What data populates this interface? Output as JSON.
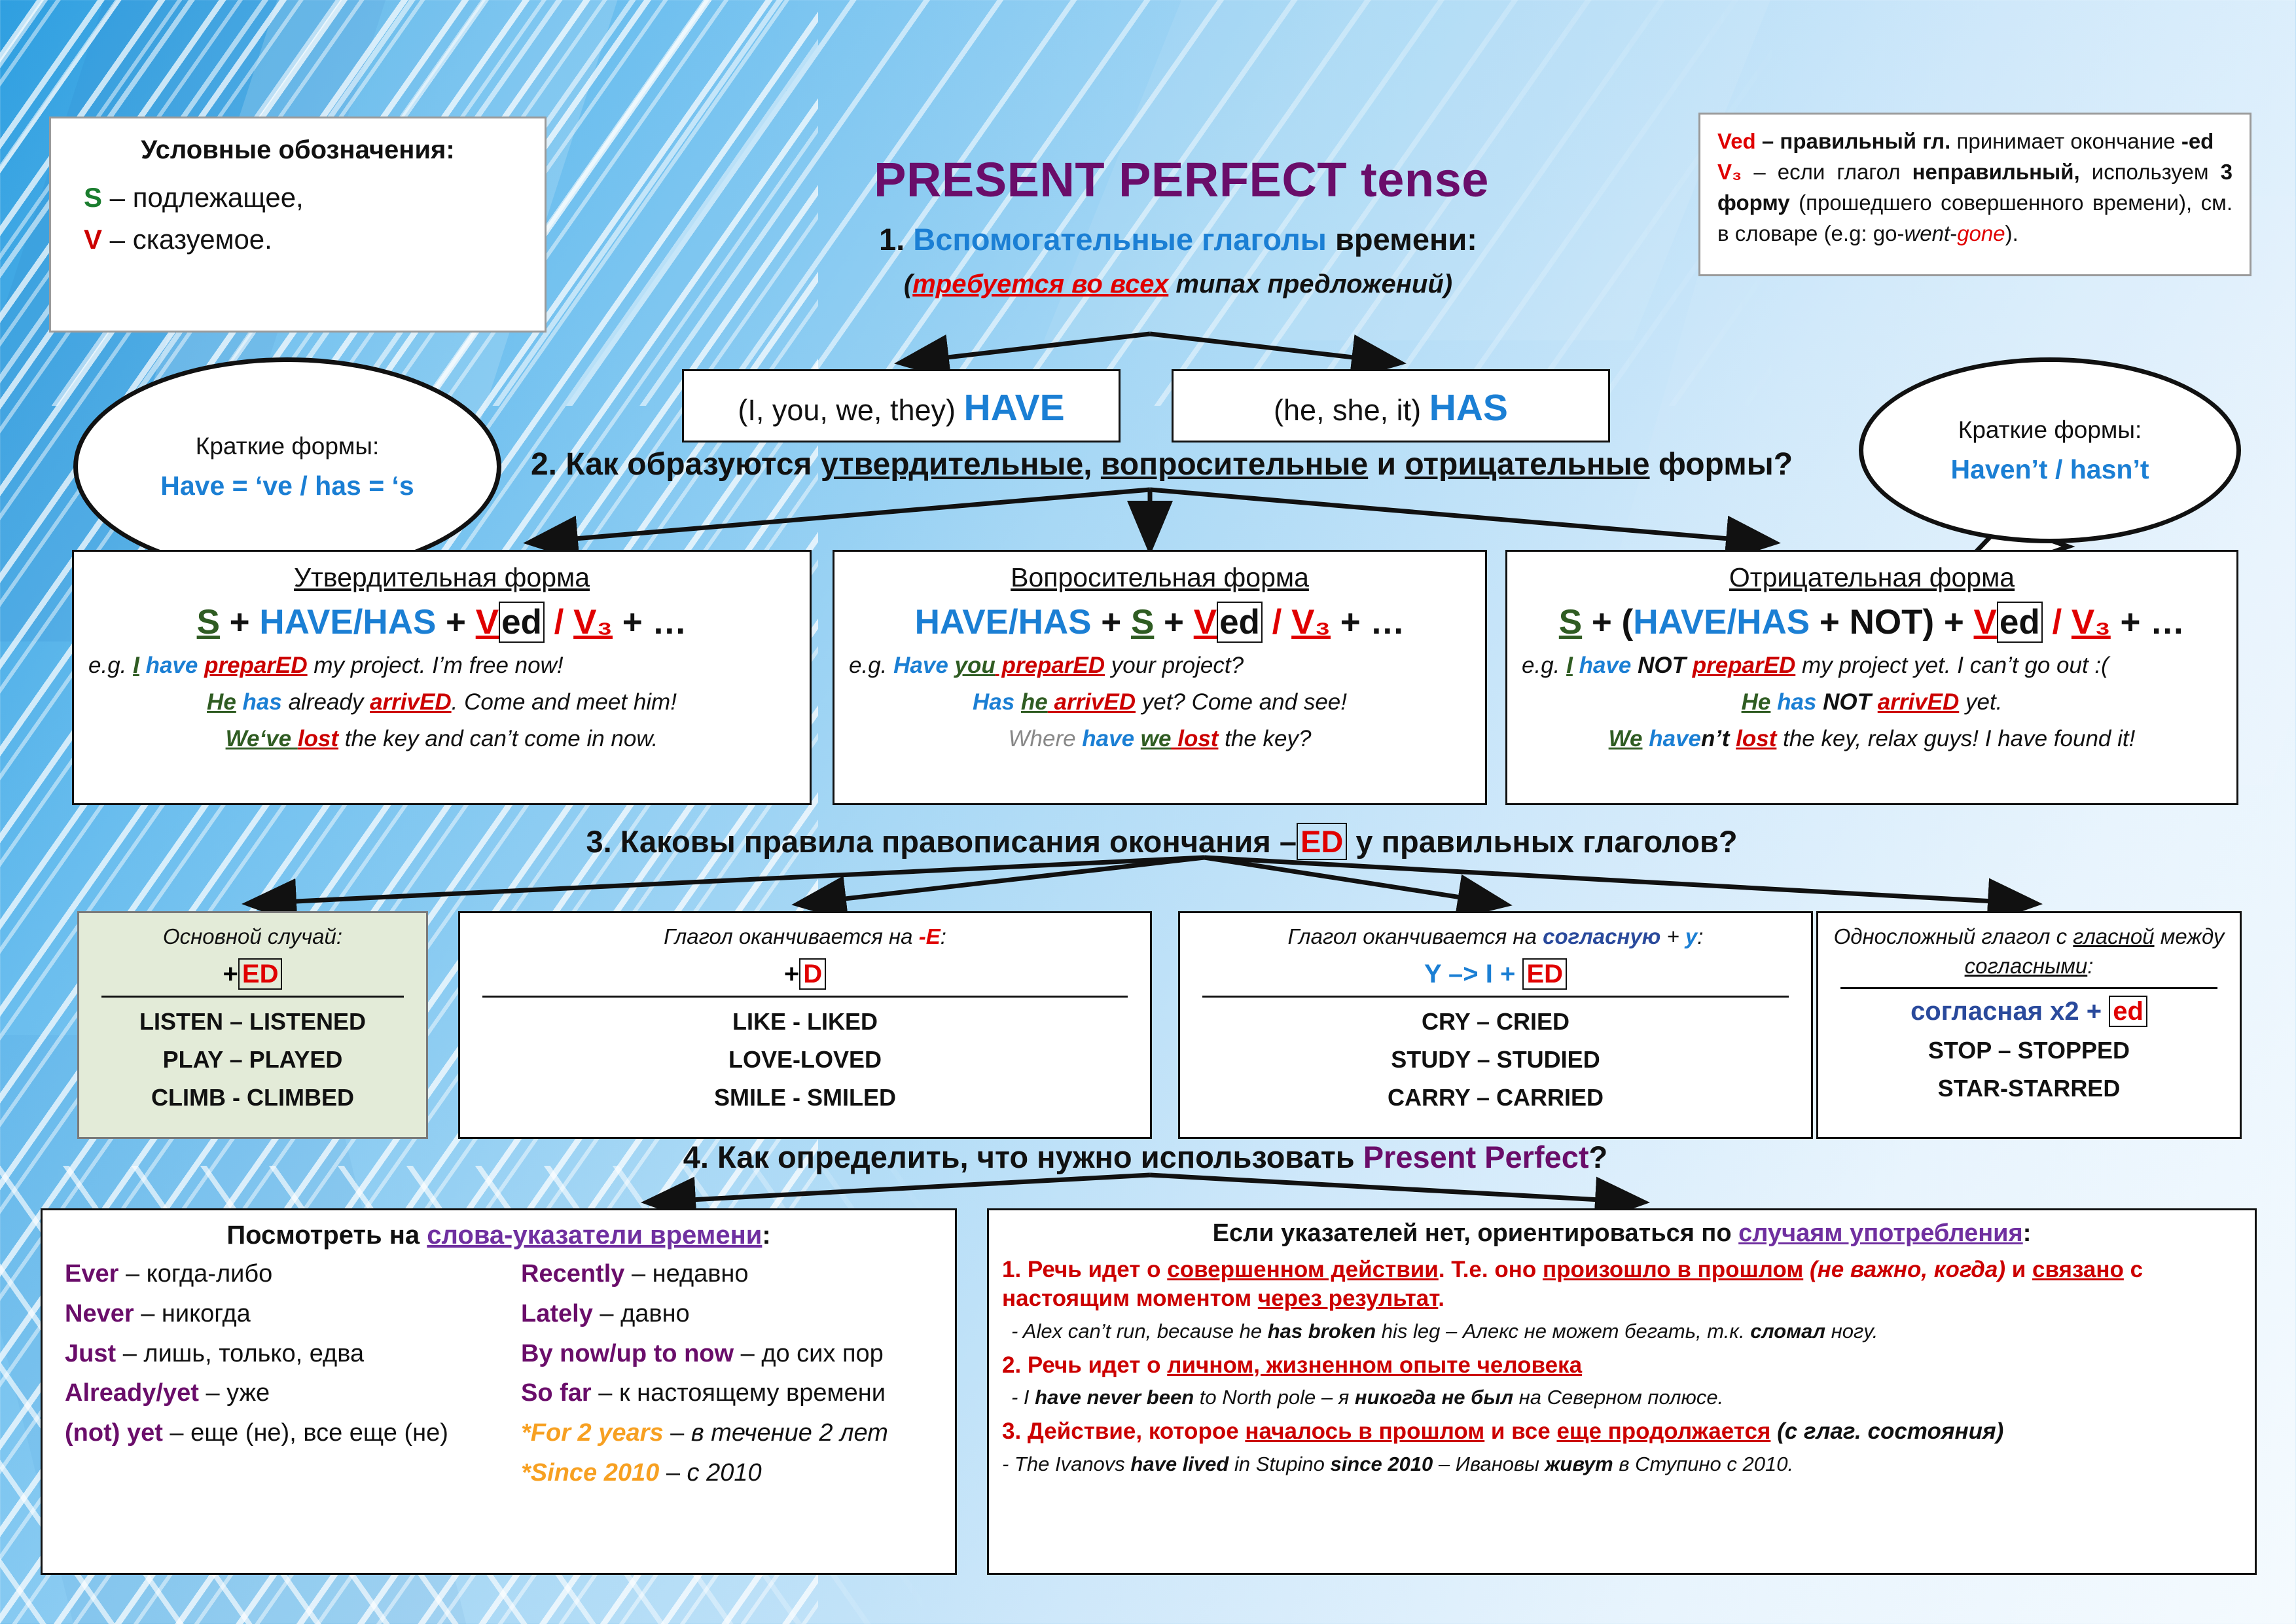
{
  "legend_left": {
    "title": "Условные обозначения:",
    "line1_sym": "S",
    "line1_text": " – подлежащее,",
    "line2_sym": "V",
    "line2_text": " – сказуемое."
  },
  "legend_right": {
    "ved_sym": "Ved",
    "ved_text_bold": " – правильный гл.",
    "ved_text": " принимает окончание ",
    "ved_end": "-ed",
    "v3_sym": "V₃",
    "v3_a": " – если глагол ",
    "v3_b": "неправильный,",
    "v3_c": " используем ",
    "v3_d": "3 форму",
    "v3_e": " (прошедшего совершенного времени), см. в словаре (e.g: go-",
    "v3_went": "went",
    "v3_dash": "-",
    "v3_gone": "gone",
    "v3_close": ")."
  },
  "title": "PRESENT PERFECT tense",
  "section1": {
    "num": "1. ",
    "blue": "Вспомогательные глаголы",
    "rest": " времени:",
    "sub_open": "(",
    "sub_red": "требуется во всех",
    "sub_rest": " типах предложений)"
  },
  "aux": {
    "have_pron": "(I, you, we, they) ",
    "have_word": "HAVE",
    "has_pron": "(he, she, it) ",
    "has_word": "HAS"
  },
  "bubble_left": {
    "title": "Краткие формы:",
    "content": "Have = ‘ve / has = ‘s"
  },
  "bubble_right": {
    "title": "Краткие формы:",
    "content": "Haven’t / hasn’t"
  },
  "section2": {
    "num": "2. Как образуются ",
    "w1": "утвердительные",
    "comma": ", ",
    "w2": "вопросительные",
    "and": " и ",
    "w3": "отрицательные",
    "end": " формы?"
  },
  "affirmative": {
    "title": "Утвердительная форма",
    "f_s": "S",
    "f_plus1": " + ",
    "f_aux": "HAVE/HAS",
    "f_plus2": " + ",
    "f_v": "V",
    "f_ed": "ed",
    "f_slash": " / ",
    "f_v3": "V₃",
    "f_tail": " + …",
    "ex1_eg": "e.g. ",
    "ex1_s": "I",
    "ex1_aux": " have ",
    "ex1_verb": "preparED",
    "ex1_rest": " my project. I’m free now!",
    "ex2_s": "He",
    "ex2_aux": " has ",
    "ex2_mid": "already ",
    "ex2_verb": "arrivED",
    "ex2_rest": ". Come and meet him!",
    "ex3_s": "We‘ve ",
    "ex3_verb": "lost",
    "ex3_rest": " the key and can’t come in now."
  },
  "question": {
    "title": "Вопросительная форма",
    "f_aux": "HAVE/HAS",
    "f_plus1": " + ",
    "f_s": "S",
    "f_plus2": " + ",
    "f_v": "V",
    "f_ed": "ed",
    "f_slash": " / ",
    "f_v3": "V₃",
    "f_tail": " + …",
    "ex1_eg": "e.g. ",
    "ex1_aux": "Have ",
    "ex1_s": "you",
    "ex1_verb": " preparED",
    "ex1_rest": " your project?",
    "ex2_aux": "Has ",
    "ex2_s": "he",
    "ex2_verb": " arrivED",
    "ex2_rest": " yet? Come and see!",
    "ex3_wh": "Where ",
    "ex3_aux": "have ",
    "ex3_s": "we",
    "ex3_verb": " lost",
    "ex3_rest": " the key?"
  },
  "negative": {
    "title": "Отрицательная форма",
    "f_s": "S",
    "f_p1": " + (",
    "f_aux": "HAVE/HAS",
    "f_p2": " + ",
    "f_not": "NOT",
    "f_p3": ") + ",
    "f_v": "V",
    "f_ed": "ed",
    "f_slash": " / ",
    "f_v3": "V₃",
    "f_tail": " + …",
    "ex1_eg": "e.g. ",
    "ex1_s": "I",
    "ex1_aux": " have ",
    "ex1_not": "NOT ",
    "ex1_verb": "preparED",
    "ex1_rest": " my project yet. I can’t go out :(",
    "ex2_s": "He",
    "ex2_aux": " has ",
    "ex2_not": "NOT ",
    "ex2_verb": "arrivED",
    "ex2_rest": " yet.",
    "ex3_s": "We",
    "ex3_aux": " have",
    "ex3_nt": "n’t ",
    "ex3_verb": "lost",
    "ex3_rest": " the key, relax guys! I have found it!"
  },
  "section3": {
    "pre": "3. Каковы правила правописания окончания –",
    "ed": "ED",
    "post": " у правильных глаголов?"
  },
  "rules": [
    {
      "head": "Основной случай:",
      "head_italic": true,
      "sign_plus": "+",
      "sign_badge": "ED",
      "examples": [
        "LISTEN – LISTENED",
        "PLAY – PLAYED",
        "CLIMB - CLIMBED"
      ]
    },
    {
      "head_a": "Глагол оканчивается на ",
      "head_b": "-E",
      "head_c": ":",
      "sign_plus": "+",
      "sign_badge": "D",
      "examples": [
        "LIKE - LIKED",
        "LOVE-LOVED",
        "SMILE - SMILED"
      ]
    },
    {
      "head_a": "Глагол оканчивается на ",
      "head_b": "согласную",
      "head_c": " + ",
      "head_d": "y",
      "head_e": ":",
      "sign": "Y –> I + ",
      "sign_badge": "ED",
      "examples": [
        "CRY – CRIED",
        "STUDY – STUDIED",
        "CARRY –  CARRIED"
      ]
    },
    {
      "head_a": "Односложный глагол с ",
      "head_b": "гласной",
      "head_c": " между ",
      "head_d": "согласными",
      "head_e": ":",
      "sign": "согласная х2 + ",
      "sign_badge": "ed",
      "examples": [
        "STOP – STOPPED",
        "STAR-STARRED"
      ]
    }
  ],
  "section4": {
    "pre": "4. Как определить, что нужно использовать ",
    "pp": "Present Perfect",
    "post": "?"
  },
  "markers": {
    "title_pre": "Посмотреть на ",
    "title_link": "слова-указатели времени",
    "title_post": ":",
    "col1": [
      {
        "word": "Ever",
        "dash": " –  ",
        "tr": "когда-либо"
      },
      {
        "word": "Never",
        "dash": " –  ",
        "tr": "никогда"
      },
      {
        "word": "Just",
        "dash": " –  ",
        "tr": "лишь, только, едва"
      },
      {
        "word": "Already/yet",
        "dash": " – ",
        "tr": "уже"
      },
      {
        "word": "(not)  yet",
        "dash": "  –  ",
        "tr": "еще (не), все еще (не)"
      }
    ],
    "col2": [
      {
        "word": "Recently",
        "dash": " – ",
        "tr": "недавно",
        "orange": false
      },
      {
        "word": "Lately",
        "dash": " – ",
        "tr": "давно",
        "orange": false
      },
      {
        "word": "By now/up to now",
        "dash": " – ",
        "tr": "до сих пор",
        "orange": false
      },
      {
        "word": "So far",
        "dash": " – ",
        "tr": "к настоящему времени",
        "orange": false
      },
      {
        "word": "*For 2 years",
        "dash": " – ",
        "tr": "в течение 2 лет",
        "orange": true
      },
      {
        "word": "*Since 2010",
        "dash": " – ",
        "tr": "с 2010",
        "orange": true
      }
    ]
  },
  "cases": {
    "title_pre": "Если указателей нет, ориентироваться по ",
    "title_link": "случаям употребления",
    "title_post": ":",
    "case1_a": "1. Речь идет о ",
    "case1_b": "совершенном действии",
    "case1_c": ". Т.е. оно ",
    "case1_d": "произошло в прошлом",
    "case1_e": " (не важно, когда)",
    "case1_f": " и ",
    "case1_g": "связано",
    "case1_h": " с настоящим моментом ",
    "case1_i": "через результат",
    "case1_j": ".",
    "ex1": "- Alex can’t run, because he has broken his leg – Алекс не может бегать, т.к. сломал ногу.",
    "ex1_en": "- Alex can’t run, because he ",
    "ex1_bold": "has broken",
    "ex1_mid": " his leg – Алекс не может бегать, т.к. ",
    "ex1_bold2": "сломал",
    "ex1_end": " ногу.",
    "case2_a": "2. Речь идет о ",
    "case2_b": "личном, жизненном опыте человека",
    "ex2_en": " - I ",
    "ex2_b1": "have never been",
    "ex2_mid": " to North pole – я ",
    "ex2_b2": "никогда не был",
    "ex2_end": " на Северном полюсе.",
    "case3_a": "3. ",
    "case3_b": "Действие, которое ",
    "case3_c": "началось в прошлом",
    "case3_d": " и все ",
    "case3_e": "еще продолжается",
    "case3_f": " (с глаг. состояния)",
    "ex3_en": "- The Ivanovs ",
    "ex3_b1": "have lived",
    "ex3_mid": " in Stupino ",
    "ex3_b2": "since 2010",
    "ex3_mid2": " – Ивановы ",
    "ex3_b3": "живут",
    "ex3_end": " в Ступино с 2010."
  },
  "colors": {
    "accent_purple": "#6a0d6a",
    "accent_blue": "#1b7fd4",
    "accent_red": "#e00000",
    "accent_green": "#1a7d2e",
    "accent_orange": "#f7a021",
    "accent_violet": "#7030a0"
  }
}
